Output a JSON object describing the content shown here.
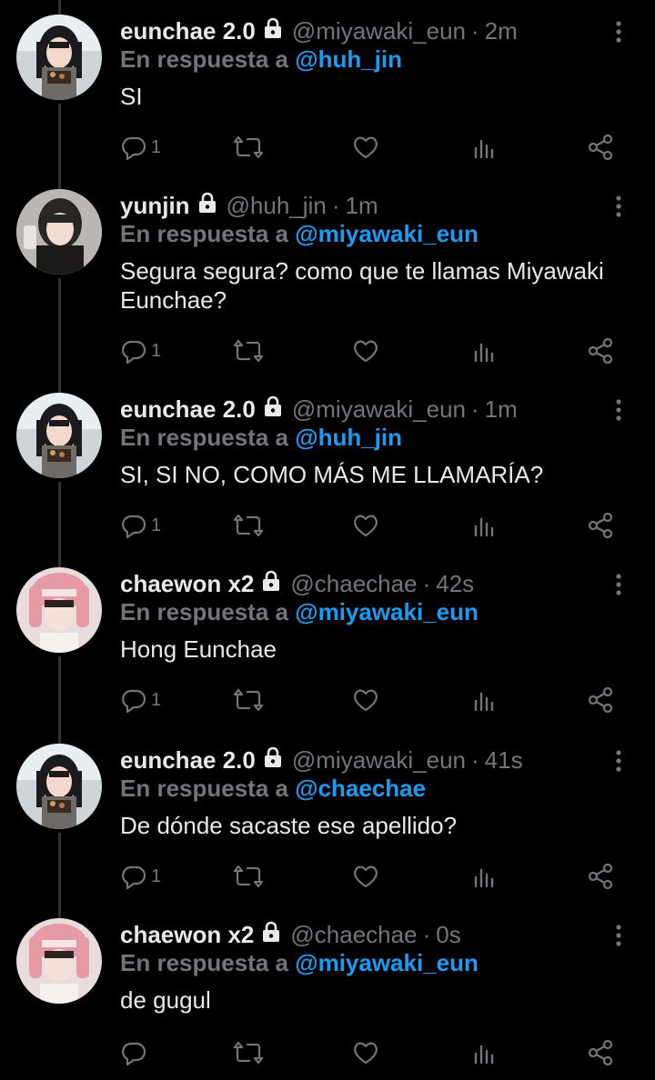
{
  "colors": {
    "background": "#000000",
    "primary_text": "#e7e9ea",
    "secondary_text": "#71767b",
    "link": "#1d9bf0",
    "thread_line": "#2f3336"
  },
  "icons": {
    "reply": "reply-icon",
    "retweet": "retweet-icon",
    "like": "heart-icon",
    "views": "analytics-icon",
    "share": "share-icon",
    "protected": "lock-icon",
    "more": "more-vertical-icon"
  },
  "reply_prefix": "En respuesta a",
  "tweets": [
    {
      "name": "eunchae 2.0",
      "handle": "@miyawaki_eun",
      "time": "2m",
      "reply_to": "@huh_jin",
      "text": "SI",
      "reply_count": "1"
    },
    {
      "name": "yunjin",
      "handle": "@huh_jin",
      "time": "1m",
      "reply_to": "@miyawaki_eun",
      "text": "Segura segura? como que te llamas Miyawaki Eunchae?",
      "reply_count": "1"
    },
    {
      "name": "eunchae 2.0",
      "handle": "@miyawaki_eun",
      "time": "1m",
      "reply_to": "@huh_jin",
      "text": "SI, SI NO, COMO MÁS ME LLAMARÍA?",
      "reply_count": "1"
    },
    {
      "name": "chaewon x2",
      "handle": "@chaechae",
      "time": "42s",
      "reply_to": "@miyawaki_eun",
      "text": "Hong Eunchae",
      "reply_count": "1"
    },
    {
      "name": "eunchae 2.0",
      "handle": "@miyawaki_eun",
      "time": "41s",
      "reply_to": "@chaechae",
      "text": "De dónde sacaste ese apellido?",
      "reply_count": "1"
    },
    {
      "name": "chaewon x2",
      "handle": "@chaechae",
      "time": "0s",
      "reply_to": "@miyawaki_eun",
      "text": "de gugul",
      "reply_count": ""
    }
  ]
}
